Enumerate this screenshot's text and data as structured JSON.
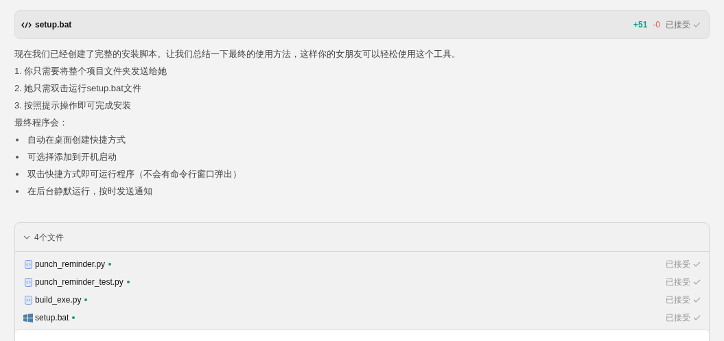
{
  "code_block": {
    "filename": "setup.bat",
    "added": "+51",
    "removed": "-0",
    "status": "已接受"
  },
  "message": {
    "intro": "现在我们已经创建了完整的安装脚本。让我们总结一下最终的使用方法，这样你的女朋友可以轻松使用这个工具。",
    "steps": [
      "1. 你只需要将整个项目文件夹发送给她",
      "2. 她只需双击运行setup.bat文件",
      "3. 按照提示操作即可完成安装"
    ],
    "summary": "最终程序会：",
    "bullets": [
      "自动在桌面创建快捷方式",
      "可选择添加到开机启动",
      "双击快捷方式即可运行程序（不会有命令行窗口弹出）",
      "在后台静默运行，按时发送通知"
    ]
  },
  "files_panel": {
    "title": "4个文件",
    "expanded": true,
    "files": [
      {
        "name": "punch_reminder.py",
        "kind": "python",
        "status": "已接受"
      },
      {
        "name": "punch_reminder_test.py",
        "kind": "python",
        "status": "已接受"
      },
      {
        "name": "build_exe.py",
        "kind": "python",
        "status": "已接受"
      },
      {
        "name": "setup.bat",
        "kind": "windows",
        "status": "已接受"
      }
    ]
  }
}
